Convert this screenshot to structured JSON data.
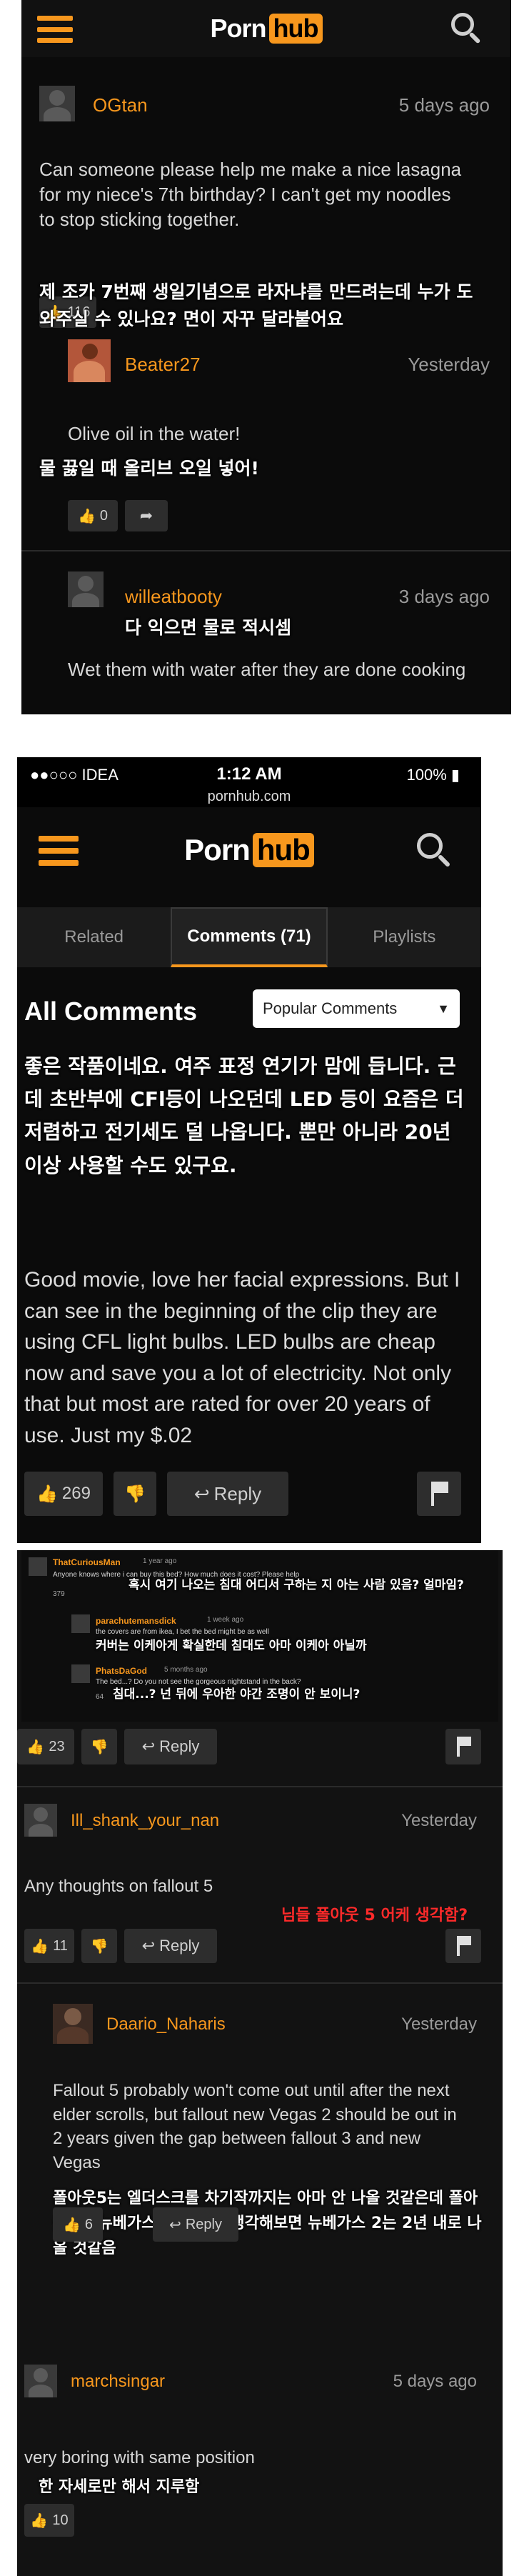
{
  "logo": {
    "left": "Porn",
    "right": "hub"
  },
  "icons": {
    "menu": "hamburger-icon",
    "search": "search-icon",
    "thumb_up": "thumbs-up-icon",
    "thumb_down": "thumbs-down-icon",
    "reply": "reply-arrow-icon",
    "flag": "flag-icon"
  },
  "colors": {
    "accent": "#f7971d",
    "bg": "#0b0b0b",
    "text": "#d8d8d8"
  },
  "shot1": {
    "comments": [
      {
        "user": "OGtan",
        "date": "5 days ago",
        "text": "Can someone please help me make a nice lasagna for my niece's 7th birthday? I can't get my noodles to stop sticking together.",
        "ko": "제 조카 7번째 생일기념으로 라자냐를 만드려는데 누가 도와주실 수 있나요? 면이 자꾸 달라붙어요",
        "likes": "116"
      },
      {
        "user": "Beater27",
        "date": "Yesterday",
        "text": "Olive oil in the water!",
        "ko": "물 끓일 때 올리브 오일 넣어!",
        "likes": "0"
      },
      {
        "user": "willeatbooty",
        "date": "3 days ago",
        "ko": "다 익으면 물로 적시셈",
        "text": "Wet them with water after they are done cooking"
      }
    ]
  },
  "shot2": {
    "status": {
      "carrier": "●●○○○ IDEA",
      "time": "1:12 AM",
      "battery": "100%",
      "url": "pornhub.com"
    },
    "tabs": [
      "Related",
      "Comments (71)",
      "Playlists"
    ],
    "all_comments": "All Comments",
    "sort_select": "Popular Comments",
    "ko": "좋은 작품이네요. 여주 표정 연기가 맘에 듭니다. 근데 초반부에 CFl등이 나오던데 LED 등이 요즘은 더 저렴하고 전기세도 덜 나옵니다. 뿐만 아니라 20년 이상 사용할 수도 있구요.",
    "text": "Good movie, love her facial expressions. But I can see in the beginning of the clip they are using CFL light bulbs. LED bulbs are cheap now and save you a lot of electricity. Not only that but most are rated for over 20 years of use. Just my $.02",
    "likes": "269",
    "reply": "Reply"
  },
  "shot3": {
    "mini": [
      {
        "user": "ThatCuriousMan",
        "date": "1 year ago",
        "text": "Anyone knows where i can buy this bed? How much does it cost? Please help",
        "ko": "혹시 여기 나오는 침대 어디서 구하는 지 아는 사람 있음? 얼마임?",
        "likes": "379"
      },
      {
        "user": "parachutemansdick",
        "date": "1 week ago",
        "text": "the covers are from ikea, I bet the bed might be as well",
        "ko": "커버는 이케아게 확실한데 침대도 아마 이케아 아닐까"
      },
      {
        "user": "PhatsDaGod",
        "date": "5 months ago",
        "text": "The bed...? Do you not see the gorgeous nightstand in the back?",
        "ko": "침대...? 넌 뒤에 우아한 야간 조명이 안 보이니?",
        "likes": "64"
      }
    ],
    "mini_likes": "23",
    "reply": "Reply",
    "comments": [
      {
        "user": "Ill_shank_your_nan",
        "date": "Yesterday",
        "text": "Any thoughts on fallout 5",
        "ko": "님들 폴아웃 5 어케 생각함?",
        "likes": "11"
      },
      {
        "user": "Daario_Naharis",
        "date": "Yesterday",
        "text": "Fallout 5 probably won't come out until after the next elder scrolls, but fallout new Vegas 2 should be out in 2 years given the gap between fallout 3 and new Vegas",
        "ko": "폴아웃5는 엘더스크롤 차기작까지는 아마 안 나올 것같은데 폴아웃3랑 뉴베가스 나온 간격 생각해보면 뉴베가스 2는 2년 내로 나올 것같음",
        "likes": "6"
      },
      {
        "user": "marchsingar",
        "date": "5 days ago",
        "text": "very boring with same position",
        "ko": "한 자세로만 해서 지루함",
        "likes": "10"
      }
    ]
  }
}
